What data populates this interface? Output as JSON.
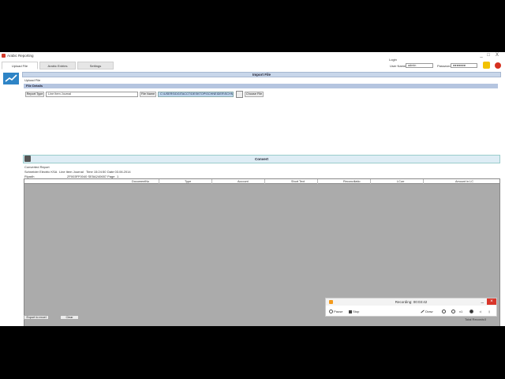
{
  "window": {
    "title": "Arabic Reporting",
    "minimize": "_",
    "maximize": "□",
    "close": "X"
  },
  "tabs": [
    {
      "label": "Upload File"
    },
    {
      "label": "Arabic Entries"
    },
    {
      "label": "Settings"
    }
  ],
  "login": {
    "title": "Login",
    "username_label": "User Name",
    "username_value": "admin",
    "password_label": "Password",
    "password_value": "●●●●●●●"
  },
  "import": {
    "section_title": "Import File",
    "breadcrumb": "Upload File",
    "details_title": "File Details",
    "report_type_label": "Report Type",
    "report_type_value": "Line Item Journal",
    "file_name_label": "File Name",
    "file_path": "C:\\USERS\\DGITACCT\\DESKTOP\\SCHNEIDER\\SCHNEIDI",
    "choose_file_label": "Choose File"
  },
  "convert": {
    "label": "Convert"
  },
  "report_info": {
    "title": "Converted Report",
    "company": "Schneider Electric KSA",
    "report_name": "Line Item Journal",
    "time": "Time 15:24:50",
    "date": "Date 03.06.2014",
    "city": "Riyadh",
    "code": "ZF003FF0040 SE5A240657 Page",
    "page": "1"
  },
  "grid": {
    "columns": [
      "DocumentNo",
      "Type",
      "Account",
      "Short Text",
      "Reconciliatio",
      "LCurr",
      "Amount in LC"
    ]
  },
  "footer": {
    "export_label": "Export to excel",
    "clear_label": "Clear",
    "total_label": "Total Records",
    "total_value": "0"
  },
  "recorder": {
    "status": "Recording: 00:03:42",
    "pause_label": "Pause",
    "stop_label": "Stop",
    "draw_label": "Draw",
    "zoom_label": "x1"
  },
  "colors": {
    "accent": "#c8d6ea",
    "grid_bg": "#ababab",
    "recorder_accent": "#f39a1c",
    "close_red": "#d9352a"
  }
}
